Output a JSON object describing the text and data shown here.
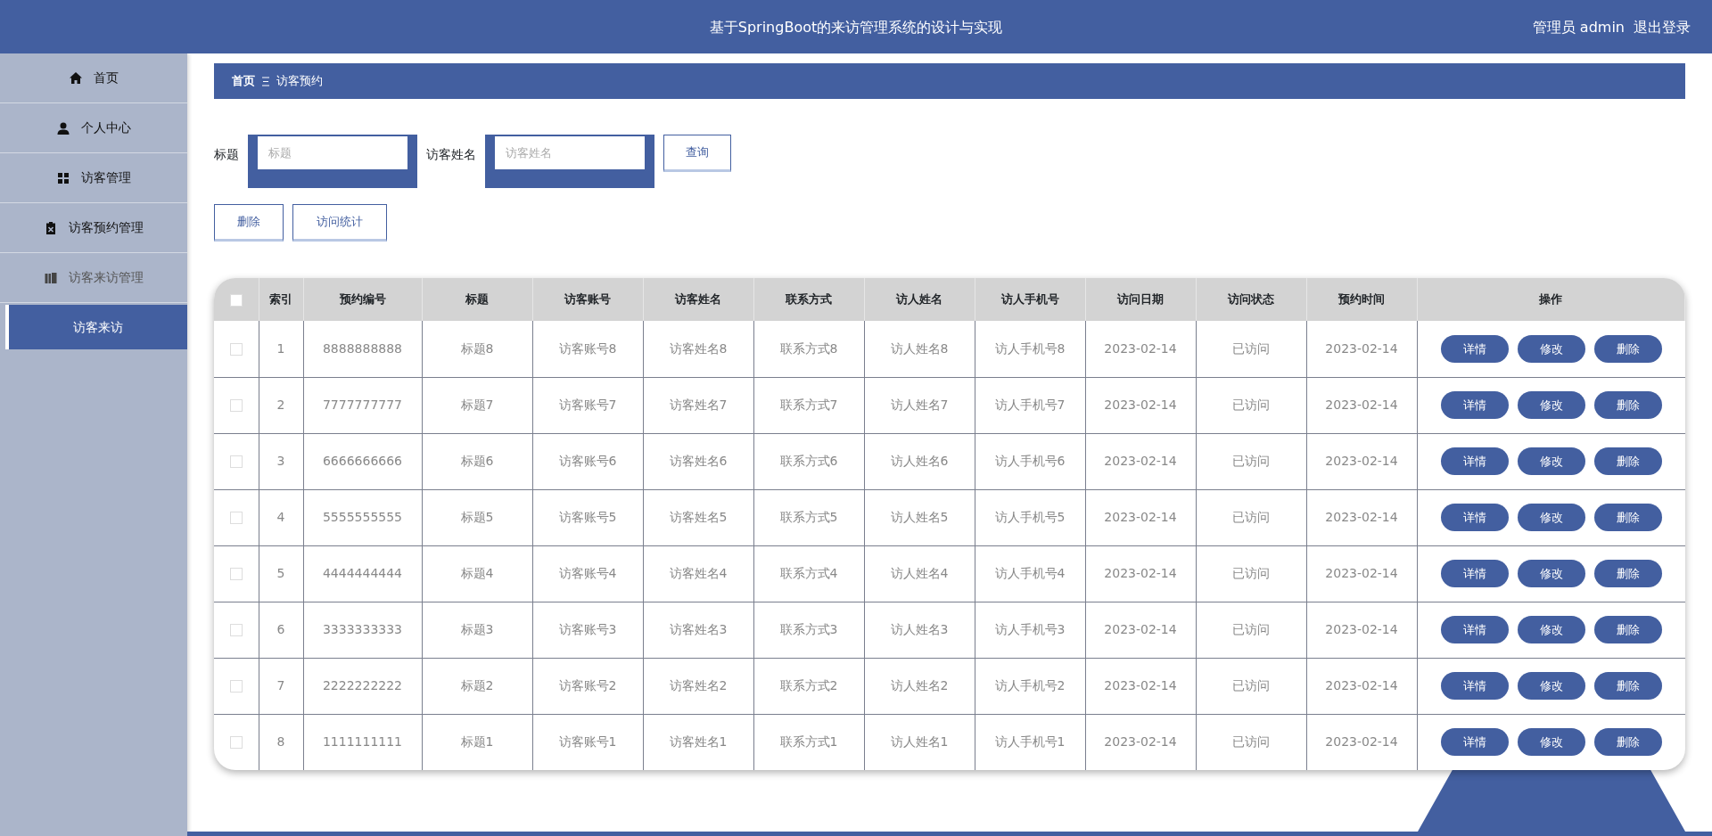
{
  "header": {
    "title": "基于SpringBoot的来访管理系统的设计与实现",
    "user": "管理员 admin",
    "logout": "退出登录"
  },
  "sidebar": {
    "items": [
      {
        "label": "首页",
        "selected": false
      },
      {
        "label": "个人中心",
        "selected": false
      },
      {
        "label": "访客管理",
        "selected": false
      },
      {
        "label": "访客预约管理",
        "selected": false
      },
      {
        "label": "访客来访管理",
        "selected": false,
        "expanded": true,
        "children": [
          {
            "label": "访客来访",
            "selected": true
          }
        ]
      }
    ]
  },
  "breadcrumb": {
    "home": "首页",
    "current": "访客预约"
  },
  "search": {
    "fields": [
      {
        "label": "标题",
        "placeholder": "标题"
      },
      {
        "label": "访客姓名",
        "placeholder": "访客姓名"
      }
    ],
    "button": "查询"
  },
  "actions": [
    "删除",
    "访问统计"
  ],
  "table": {
    "all_checked": false,
    "columns": [
      "索引",
      "预约编号",
      "标题",
      "访客账号",
      "访客姓名",
      "联系方式",
      "访人姓名",
      "访人手机号",
      "访问日期",
      "访问状态",
      "预约时间",
      "操作"
    ],
    "rows": [
      {
        "checked": false,
        "cells": [
          "1",
          "8888888888",
          "标题8",
          "访客账号8",
          "访客姓名8",
          "联系方式8",
          "访人姓名8",
          "访人手机号8",
          "2023-02-14",
          "已访问",
          "2023-02-14"
        ],
        "actions": [
          "详情",
          "修改",
          "删除"
        ]
      },
      {
        "checked": false,
        "cells": [
          "2",
          "7777777777",
          "标题7",
          "访客账号7",
          "访客姓名7",
          "联系方式7",
          "访人姓名7",
          "访人手机号7",
          "2023-02-14",
          "已访问",
          "2023-02-14"
        ],
        "actions": [
          "详情",
          "修改",
          "删除"
        ]
      },
      {
        "checked": false,
        "cells": [
          "3",
          "6666666666",
          "标题6",
          "访客账号6",
          "访客姓名6",
          "联系方式6",
          "访人姓名6",
          "访人手机号6",
          "2023-02-14",
          "已访问",
          "2023-02-14"
        ],
        "actions": [
          "详情",
          "修改",
          "删除"
        ]
      },
      {
        "checked": false,
        "cells": [
          "4",
          "5555555555",
          "标题5",
          "访客账号5",
          "访客姓名5",
          "联系方式5",
          "访人姓名5",
          "访人手机号5",
          "2023-02-14",
          "已访问",
          "2023-02-14"
        ],
        "actions": [
          "详情",
          "修改",
          "删除"
        ]
      },
      {
        "checked": false,
        "cells": [
          "5",
          "4444444444",
          "标题4",
          "访客账号4",
          "访客姓名4",
          "联系方式4",
          "访人姓名4",
          "访人手机号4",
          "2023-02-14",
          "已访问",
          "2023-02-14"
        ],
        "actions": [
          "详情",
          "修改",
          "删除"
        ]
      },
      {
        "checked": false,
        "cells": [
          "6",
          "3333333333",
          "标题3",
          "访客账号3",
          "访客姓名3",
          "联系方式3",
          "访人姓名3",
          "访人手机号3",
          "2023-02-14",
          "已访问",
          "2023-02-14"
        ],
        "actions": [
          "详情",
          "修改",
          "删除"
        ]
      },
      {
        "checked": false,
        "cells": [
          "7",
          "2222222222",
          "标题2",
          "访客账号2",
          "访客姓名2",
          "联系方式2",
          "访人姓名2",
          "访人手机号2",
          "2023-02-14",
          "已访问",
          "2023-02-14"
        ],
        "actions": [
          "详情",
          "修改",
          "删除"
        ]
      },
      {
        "checked": false,
        "cells": [
          "8",
          "1111111111",
          "标题1",
          "访客账号1",
          "访客姓名1",
          "联系方式1",
          "访人姓名1",
          "访人手机号1",
          "2023-02-14",
          "已访问",
          "2023-02-14"
        ],
        "actions": [
          "详情",
          "修改",
          "删除"
        ]
      }
    ]
  }
}
